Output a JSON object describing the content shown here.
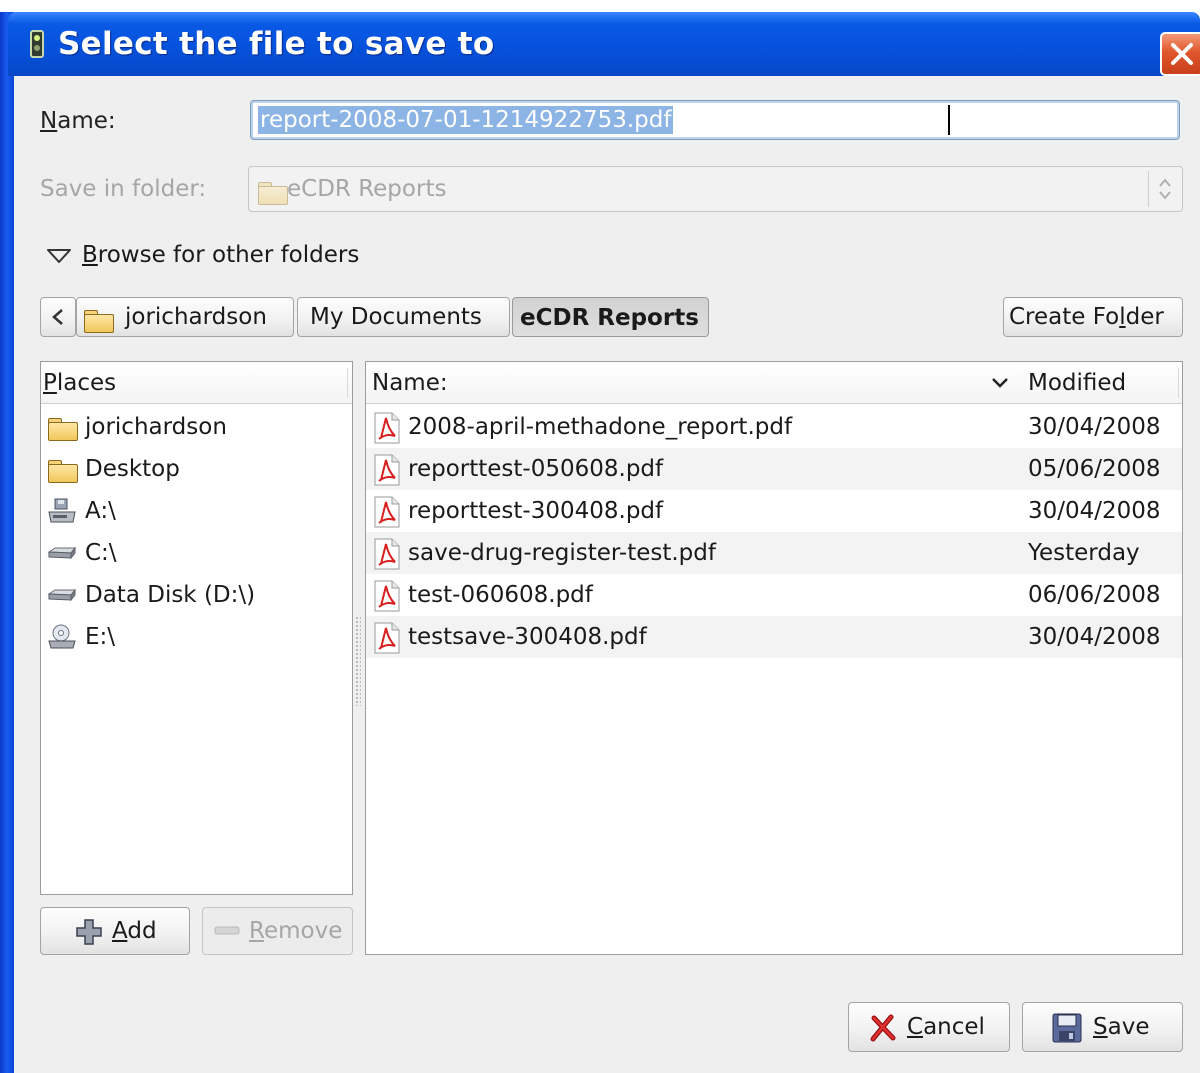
{
  "window": {
    "title": "Select the file to save to"
  },
  "form": {
    "name_label_prefix": "",
    "name_label_mnemonic": "N",
    "name_label_rest": "ame:",
    "name_value": "report-2008-07-01-1214922753.pdf",
    "save_in_label": "Save in folder:",
    "save_in_value": "eCDR Reports"
  },
  "browse": {
    "mnemonic": "B",
    "label_rest": "rowse for other folders"
  },
  "path_bar": {
    "segments": [
      {
        "label": "jorichardson"
      },
      {
        "label": "My Documents"
      },
      {
        "label": "eCDR Reports"
      }
    ],
    "create_folder": {
      "pre": "Create Fo",
      "mnemonic": "l",
      "post": "der"
    }
  },
  "places": {
    "header_mnemonic": "P",
    "header_rest": "laces",
    "items": [
      {
        "label": "jorichardson",
        "icon": "folder-icon"
      },
      {
        "label": "Desktop",
        "icon": "folder-icon"
      },
      {
        "label": "A:\\",
        "icon": "floppy-drive-icon"
      },
      {
        "label": "C:\\",
        "icon": "hard-drive-icon"
      },
      {
        "label": "Data Disk (D:\\)",
        "icon": "hard-drive-icon"
      },
      {
        "label": "E:\\",
        "icon": "cdrom-drive-icon"
      }
    ],
    "add": {
      "mnemonic": "A",
      "rest": "dd"
    },
    "remove": {
      "mnemonic": "R",
      "rest": "emove"
    }
  },
  "files": {
    "col_name": "Name:",
    "col_modified": "Modified",
    "rows": [
      {
        "name": "2008-april-methadone_report.pdf",
        "modified": "30/04/2008"
      },
      {
        "name": "reporttest-050608.pdf",
        "modified": "05/06/2008"
      },
      {
        "name": "reporttest-300408.pdf",
        "modified": "30/04/2008"
      },
      {
        "name": "save-drug-register-test.pdf",
        "modified": "Yesterday"
      },
      {
        "name": "test-060608.pdf",
        "modified": "06/06/2008"
      },
      {
        "name": "testsave-300408.pdf",
        "modified": "30/04/2008"
      }
    ]
  },
  "actions": {
    "cancel": {
      "mnemonic": "C",
      "rest": "ancel"
    },
    "save": {
      "mnemonic": "S",
      "rest": "ave"
    }
  },
  "colors": {
    "titlebar": "#0652dc",
    "selection": "#8cb4e4",
    "close": "#e0562c"
  }
}
